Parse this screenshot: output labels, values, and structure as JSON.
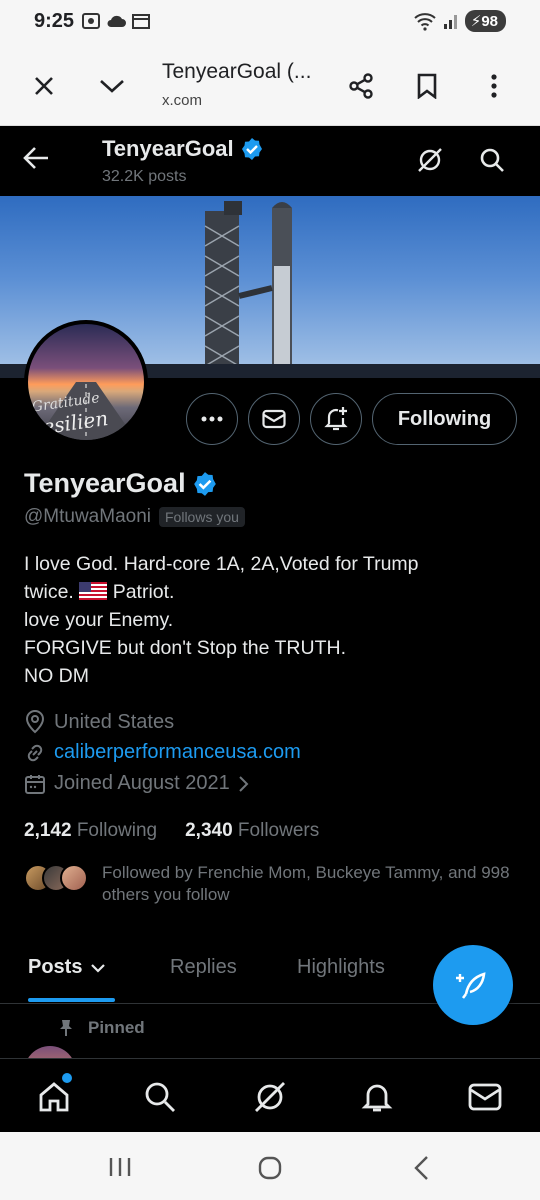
{
  "status_bar": {
    "time": "9:25",
    "battery": "98"
  },
  "browser": {
    "page_title": "TenyearGoal (...",
    "domain": "x.com"
  },
  "header": {
    "name": "TenyearGoal",
    "post_count": "32.2K posts"
  },
  "profile": {
    "display_name": "TenyearGoal",
    "handle": "@MtuwaMaoni",
    "follows_you_badge": "Follows you",
    "follow_button_label": "Following",
    "bio_lines": [
      "I love God. Hard-core 1A, 2A,Voted for Trump",
      "twice.",
      "Patriot.",
      "love your Enemy.",
      "FORGIVE but don't Stop the TRUTH.",
      "NO DM"
    ],
    "location": "United States",
    "website": "caliberperformanceusa.com",
    "joined": "Joined August 2021",
    "following_count": "2,142",
    "following_label": "Following",
    "followers_count": "2,340",
    "followers_label": "Followers",
    "followed_by_text": "Followed by Frenchie Mom, Buckeye Tammy, and 998 others you follow"
  },
  "tabs": [
    {
      "label": "Posts"
    },
    {
      "label": "Replies"
    },
    {
      "label": "Highlights"
    }
  ],
  "pinned": {
    "label": "Pinned"
  },
  "colors": {
    "accent": "#1d9bf0",
    "background": "#000000",
    "muted": "#71767b"
  },
  "icons": {
    "status": [
      "photo-icon",
      "cloud-icon",
      "calendar-icon",
      "wifi-icon",
      "signal-icon",
      "battery-icon"
    ],
    "bottom_nav": [
      "home-icon",
      "search-icon",
      "grok-icon",
      "bell-icon",
      "mail-icon"
    ]
  }
}
